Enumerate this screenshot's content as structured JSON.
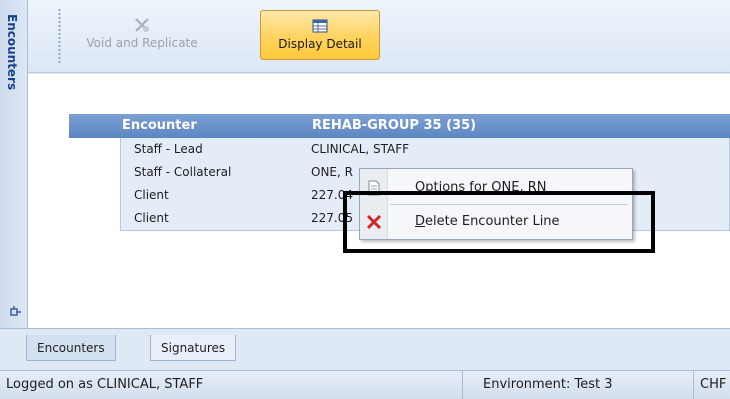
{
  "side_tab": {
    "label": "Encounters"
  },
  "toolbar": {
    "void_label": "Void and Replicate",
    "detail_label": "Display Detail"
  },
  "grid": {
    "header": {
      "col1": "Encounter",
      "col2": "REHAB-GROUP 35 (35)"
    },
    "rows": [
      {
        "col1": "Staff - Lead",
        "col2": "CLINICAL, STAFF"
      },
      {
        "col1": "Staff - Collateral",
        "col2": "ONE, R"
      },
      {
        "col1": "Client",
        "col2": "227.04"
      },
      {
        "col1": "Client",
        "col2": "227.05"
      }
    ]
  },
  "context_menu": {
    "item1": "Options for ONE, RN",
    "item2_accel": "D",
    "item2_rest": "elete Encounter Line"
  },
  "bottom_tabs": [
    "Encounters",
    "Signatures"
  ],
  "status": {
    "user": "Logged on as CLINICAL, STAFF",
    "environment": "Environment: Test 3",
    "extra": "CHF"
  },
  "colors": {
    "header_blue": "#5d86c2",
    "active_button_gold": "#ffd35e",
    "delete_red": "#d0262a",
    "highlight_border": "#000000"
  }
}
